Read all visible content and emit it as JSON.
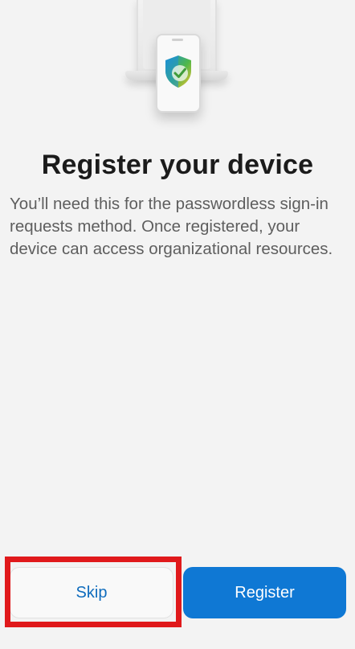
{
  "hero": {
    "illustration_icon": "device-shield-check-icon",
    "shield_colors": [
      "#1b8fd9",
      "#4fb84a",
      "#f2c12e"
    ]
  },
  "content": {
    "title": "Register your device",
    "description": "You’ll need this for the passwordless sign-in requests method. Once registered, your device can access organizational resources."
  },
  "actions": {
    "skip_label": "Skip",
    "register_label": "Register"
  },
  "colors": {
    "background": "#f3f3f3",
    "primary": "#0f78d4",
    "link": "#0f6cbd",
    "highlight": "#e0191b"
  }
}
